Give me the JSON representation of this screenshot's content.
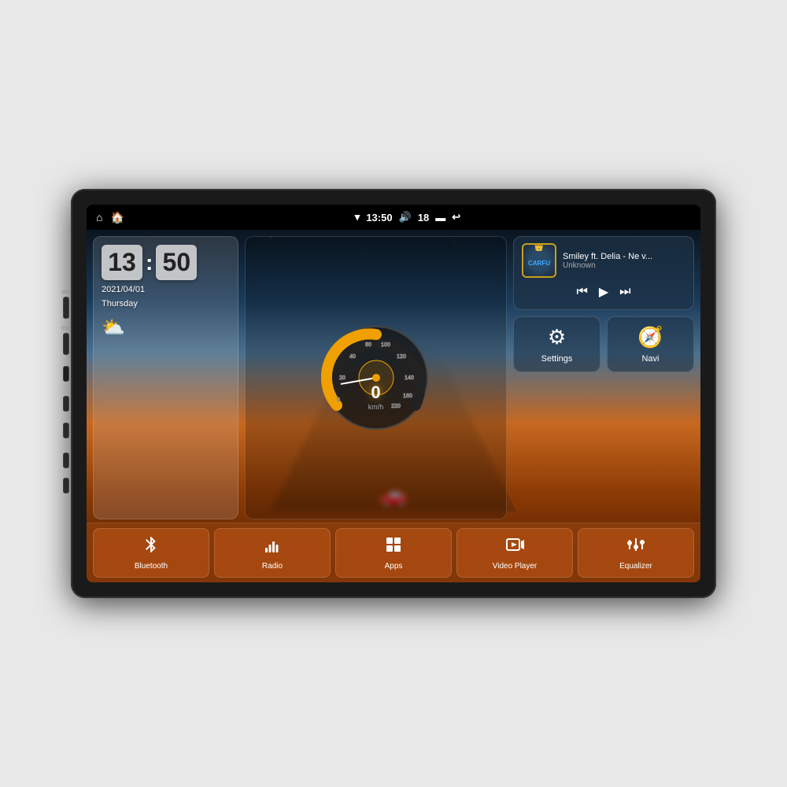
{
  "device": {
    "side_labels": [
      "MIC",
      "RST"
    ]
  },
  "status_bar": {
    "left_icons": [
      "home",
      "house"
    ],
    "time": "13:50",
    "volume": "18",
    "right_icons": [
      "battery",
      "back"
    ]
  },
  "clock": {
    "hours": "13",
    "minutes": "50",
    "date": "2021/04/01",
    "day": "Thursday"
  },
  "speedometer": {
    "value": "0",
    "unit": "km/h",
    "max": 220
  },
  "music": {
    "title": "Smiley ft. Delia - Ne v...",
    "artist": "Unknown",
    "album_label": "CARFU",
    "controls": {
      "prev": "⏮",
      "play": "▶",
      "next": "⏭"
    }
  },
  "widgets": {
    "settings_label": "Settings",
    "navi_label": "Navi"
  },
  "app_bar": [
    {
      "id": "bluetooth",
      "label": "Bluetooth",
      "icon": "bluetooth"
    },
    {
      "id": "radio",
      "label": "Radio",
      "icon": "radio"
    },
    {
      "id": "apps",
      "label": "Apps",
      "icon": "apps"
    },
    {
      "id": "video_player",
      "label": "Video Player",
      "icon": "video"
    },
    {
      "id": "equalizer",
      "label": "Equalizer",
      "icon": "equalizer"
    }
  ]
}
